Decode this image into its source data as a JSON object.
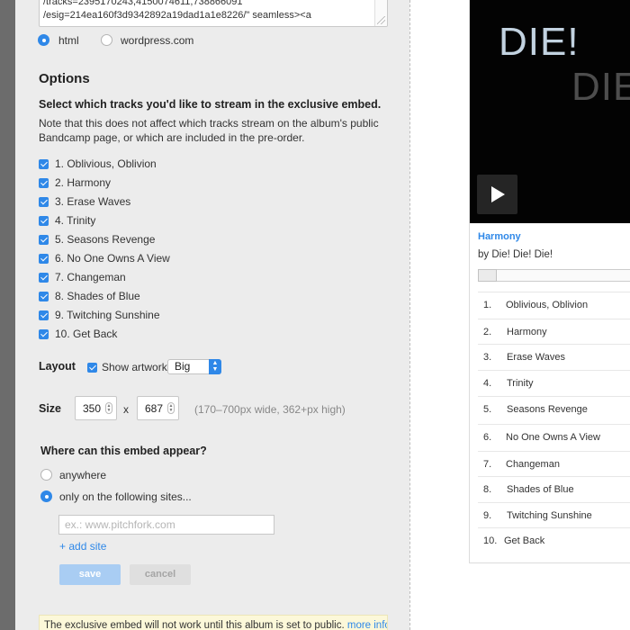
{
  "embed_code": {
    "lines": [
      "/tracks=2395170243,4150074611,738866091",
      "/esig=214ea160f3d9342892a19dad1a1e8226/\" seamless><a"
    ]
  },
  "format": {
    "options": [
      {
        "label": "html",
        "selected": true
      },
      {
        "label": "wordpress.com",
        "selected": false
      }
    ]
  },
  "options": {
    "heading": "Options",
    "select_heading": "Select which tracks you'd like to stream in the exclusive embed.",
    "note": "Note that this does not affect which tracks stream on the album's public Bandcamp page, or which are included in the pre-order."
  },
  "tracks": [
    {
      "label": "1. Oblivious, Oblivion",
      "checked": true
    },
    {
      "label": "2. Harmony",
      "checked": true
    },
    {
      "label": "3. Erase Waves",
      "checked": true
    },
    {
      "label": "4. Trinity",
      "checked": true
    },
    {
      "label": "5. Seasons Revenge",
      "checked": true
    },
    {
      "label": "6. No One Owns A View",
      "checked": true
    },
    {
      "label": "7. Changeman",
      "checked": true
    },
    {
      "label": "8. Shades of Blue",
      "checked": true
    },
    {
      "label": "9. Twitching Sunshine",
      "checked": true
    },
    {
      "label": "10. Get Back",
      "checked": true
    }
  ],
  "layout": {
    "label": "Layout",
    "show_artwork_label": "Show artwork",
    "show_artwork_checked": true,
    "artwork_size": "Big"
  },
  "size": {
    "label": "Size",
    "width": "350",
    "times": "x",
    "height": "687",
    "hint": "(170–700px wide, 362+px high)"
  },
  "where": {
    "heading": "Where can this embed appear?",
    "options": [
      {
        "label": "anywhere",
        "selected": false
      },
      {
        "label": "only on the following sites...",
        "selected": true
      }
    ],
    "sites_placeholder": "ex.: www.pitchfork.com",
    "add_site": "+ add site",
    "save": "save",
    "cancel": "cancel"
  },
  "notice": {
    "text": "The exclusive embed will not work until this album is set to public.",
    "link": "more info"
  },
  "preview": {
    "artwork_text_1": "DIE!",
    "artwork_text_2": "DIE",
    "current_track": "Harmony",
    "artist_line": "by Die! Die! Die!",
    "tracklist": [
      {
        "num": "1.",
        "title": "Oblivious, Oblivion"
      },
      {
        "num": "2.",
        "title": "Harmony"
      },
      {
        "num": "3.",
        "title": "Erase Waves"
      },
      {
        "num": "4.",
        "title": "Trinity"
      },
      {
        "num": "5.",
        "title": "Seasons Revenge"
      },
      {
        "num": "6.",
        "title": "No One Owns A View"
      },
      {
        "num": "7.",
        "title": "Changeman"
      },
      {
        "num": "8.",
        "title": "Shades of Blue"
      },
      {
        "num": "9.",
        "title": "Twitching Sunshine"
      },
      {
        "num": "10.",
        "title": "Get Back"
      }
    ]
  },
  "colors": {
    "accent": "#2f88e8",
    "panel": "#ececec",
    "artwork_bg": "#030303"
  }
}
